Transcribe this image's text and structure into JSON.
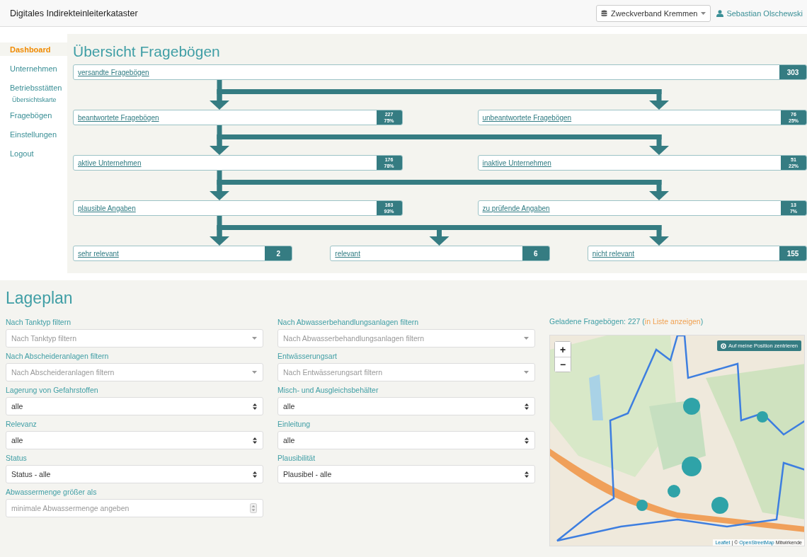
{
  "header": {
    "title": "Digitales Indirekteinleiterkataster",
    "organization": "Zweckverband Kremmen",
    "user": "Sebastian Olschewski"
  },
  "sidebar": {
    "items": [
      {
        "label": "Dashboard",
        "selected": true
      },
      {
        "label": "Unternehmen",
        "selected": false
      },
      {
        "label": "Betriebsstätten",
        "selected": false,
        "children": [
          {
            "label": "Übersichtskarte",
            "selected": false
          }
        ]
      },
      {
        "label": "Fragebögen",
        "selected": false
      },
      {
        "label": "Einstellungen",
        "selected": false
      },
      {
        "label": "Logout",
        "selected": false
      }
    ]
  },
  "overview": {
    "title": "Übersicht Fragebögen",
    "rows": [
      {
        "nodes": [
          {
            "label": "versandte Fragebögen",
            "count": "303"
          }
        ]
      },
      {
        "nodes": [
          {
            "label": "beantwortete Fragebögen",
            "count": "227",
            "percent": "75%"
          },
          {
            "label": "unbeantwortete Fragebögen",
            "count": "76",
            "percent": "25%"
          }
        ]
      },
      {
        "nodes": [
          {
            "label": "aktive Unternehmen",
            "count": "176",
            "percent": "78%"
          },
          {
            "label": "inaktive Unternehmen",
            "count": "51",
            "percent": "22%"
          }
        ]
      },
      {
        "nodes": [
          {
            "label": "plausible Angaben",
            "count": "163",
            "percent": "93%"
          },
          {
            "label": "zu prüfende Angaben",
            "count": "13",
            "percent": "7%"
          }
        ]
      },
      {
        "nodes": [
          {
            "label": "sehr relevant",
            "count": "2"
          },
          {
            "label": "relevant",
            "count": "6"
          },
          {
            "label": "nicht relevant",
            "count": "155"
          }
        ]
      }
    ]
  },
  "site_plan": {
    "title": "Lageplan",
    "filters": [
      {
        "label": "Nach Tanktyp filtern",
        "kind": "multiselect",
        "placeholder": "Nach Tanktyp filtern"
      },
      {
        "label": "Nach Abwasserbehandlungsanlagen filtern",
        "kind": "multiselect",
        "placeholder": "Nach Abwasserbehandlungsanlagen filtern"
      },
      {
        "label": "Nach Abscheideranlagen filtern",
        "kind": "multiselect",
        "placeholder": "Nach Abscheideranlagen filtern"
      },
      {
        "label": "Entwässerungsart",
        "kind": "multiselect",
        "placeholder": "Nach Entwässerungsart filtern"
      },
      {
        "label": "Lagerung von Gefahrstoffen",
        "kind": "select",
        "value": "alle"
      },
      {
        "label": "Misch- und Ausgleichsbehälter",
        "kind": "select",
        "value": "alle"
      },
      {
        "label": "Relevanz",
        "kind": "select",
        "value": "alle"
      },
      {
        "label": "Einleitung",
        "kind": "select",
        "value": "alle"
      },
      {
        "label": "Status",
        "kind": "select",
        "value": "Status - alle"
      },
      {
        "label": "Plausibilität",
        "kind": "select",
        "value": "Plausibel - alle"
      },
      {
        "label": "Abwassermenge größer als",
        "kind": "number",
        "placeholder": "minimale Abwassermenge angeben"
      }
    ],
    "map": {
      "loaded_text": "Geladene Fragebögen: 227 (",
      "list_link": "in Liste anzeigen",
      "loaded_suffix": ")",
      "zoom_in": "+",
      "zoom_out": "−",
      "locate_button": "Auf meine Position zentrieren",
      "attribution": {
        "leaflet_link": "Leaflet",
        "separator": "| ©",
        "osm_link": "OpenStreetMap",
        "suffix": "Mitwirkende"
      }
    }
  }
}
